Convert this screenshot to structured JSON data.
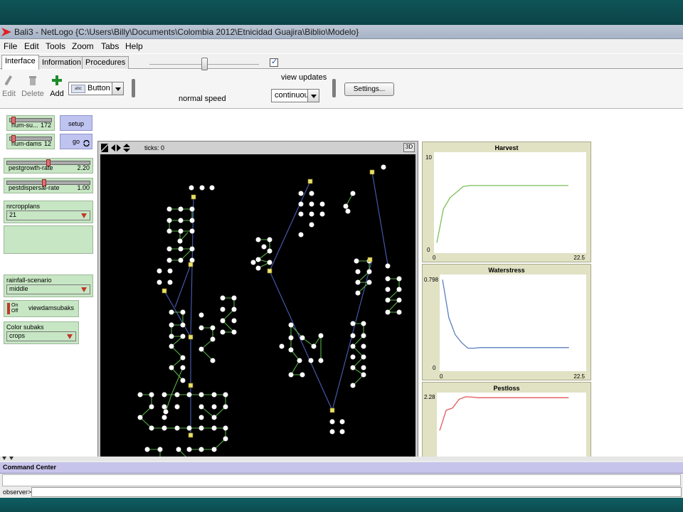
{
  "window": {
    "title": "Bali3 - NetLogo {C:\\Users\\Billy\\Documents\\Colombia 2012\\Etnicidad Guajira\\Biblio\\Modelo}"
  },
  "menu": [
    "File",
    "Edit",
    "Tools",
    "Zoom",
    "Tabs",
    "Help"
  ],
  "tabs": [
    {
      "label": "Interface",
      "active": true
    },
    {
      "label": "Information",
      "active": false
    },
    {
      "label": "Procedures",
      "active": false
    }
  ],
  "toolbar": {
    "edit": "Edit",
    "delete": "Delete",
    "add": "Add",
    "widget_type": "Button",
    "widget_tag": "abc",
    "speed_label": "normal speed",
    "view_updates_label": "view updates",
    "view_updates_checked": true,
    "update_mode": "continuous",
    "settings": "Settings..."
  },
  "widgets": {
    "num_subaks": {
      "label": "num-su...",
      "value": "172",
      "position_fraction": 0.05
    },
    "num_dams": {
      "label": "num-dams",
      "value": "12",
      "position_fraction": 0.05
    },
    "setup": "setup",
    "go": "go",
    "pestgrowth": {
      "label": "pestgrowth-rate",
      "value": "2.20",
      "position_fraction": 0.5
    },
    "pestdispersal": {
      "label": "pestdispersal-rate",
      "value": "1.00",
      "position_fraction": 0.45
    },
    "nrcropplans": {
      "label": "nrcropplans",
      "value": "21"
    },
    "rainfall": {
      "label": "rainfall-scenario",
      "value": "middle"
    },
    "viewdamsubaks": {
      "label": "viewdamsubaks",
      "on": "On",
      "off": "Off"
    },
    "color_subaks": {
      "label": "Color subaks",
      "value": "crops"
    }
  },
  "view": {
    "ticks_label": "ticks: 0",
    "btn_3d": "3D"
  },
  "plots": [
    {
      "title": "Harvest",
      "ymax": "10",
      "ymin": "0",
      "xmin": "0",
      "xmax": "22.5",
      "color": "#7bbf5a",
      "series": [
        [
          0,
          0.8
        ],
        [
          1,
          4.4
        ],
        [
          2,
          5.6
        ],
        [
          3,
          6.2
        ],
        [
          4,
          6.8
        ],
        [
          5,
          6.9
        ],
        [
          6,
          6.9
        ],
        [
          8,
          6.9
        ],
        [
          10,
          6.9
        ],
        [
          12,
          6.9
        ],
        [
          15,
          6.9
        ],
        [
          20,
          6.9
        ]
      ]
    },
    {
      "title": "Waterstress",
      "ymax": "0.798",
      "ymin": "0",
      "xmin": "0",
      "xmax": "22.5",
      "color": "#5a7fbf",
      "series": [
        [
          0,
          0.79
        ],
        [
          1,
          0.45
        ],
        [
          2,
          0.3
        ],
        [
          3,
          0.23
        ],
        [
          4,
          0.18
        ],
        [
          5,
          0.18
        ],
        [
          6,
          0.185
        ],
        [
          8,
          0.185
        ],
        [
          10,
          0.185
        ],
        [
          12,
          0.185
        ],
        [
          15,
          0.185
        ],
        [
          20,
          0.185
        ]
      ]
    },
    {
      "title": "Pestloss",
      "ymax": "2.28",
      "ymin": "",
      "xmin": "",
      "xmax": "",
      "color": "#e05a5a",
      "series": [
        [
          0,
          1.2
        ],
        [
          1,
          1.85
        ],
        [
          2,
          1.92
        ],
        [
          3,
          2.2
        ],
        [
          4,
          2.28
        ],
        [
          5,
          2.27
        ],
        [
          6,
          2.25
        ],
        [
          8,
          2.25
        ],
        [
          10,
          2.25
        ],
        [
          12,
          2.25
        ],
        [
          15,
          2.25
        ],
        [
          20,
          2.25
        ]
      ]
    }
  ],
  "command_center": {
    "title": "Command Center",
    "prompt": "observer>"
  }
}
